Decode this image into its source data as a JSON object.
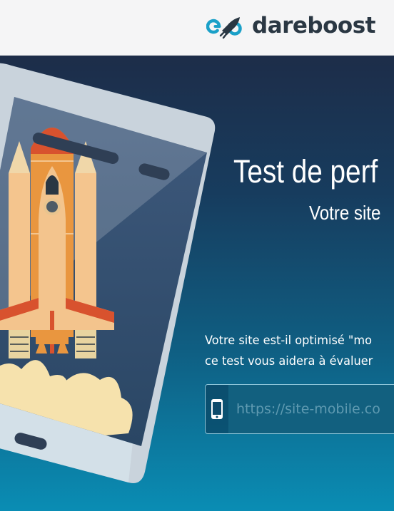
{
  "header": {
    "brand_name": "dareboost",
    "logo_icon": "rocket-infinity-logo-icon"
  },
  "hero": {
    "title": "Test de perf",
    "subtitle": "Votre site",
    "description_line1": "Votre site est-il optimisé \"mo",
    "description_line2": "ce test vous aidera à évaluer",
    "illustration": "phone-rocket-illustration"
  },
  "form": {
    "url_placeholder": "https://site-mobile.co",
    "url_value": "",
    "device_icon": "smartphone-icon"
  },
  "colors": {
    "header_bg": "#f5f5f6",
    "brand_text": "#2a3743",
    "brand_accent": "#1aa0c8",
    "hero_top": "#1d2d49",
    "hero_bottom": "#0a8db4"
  }
}
